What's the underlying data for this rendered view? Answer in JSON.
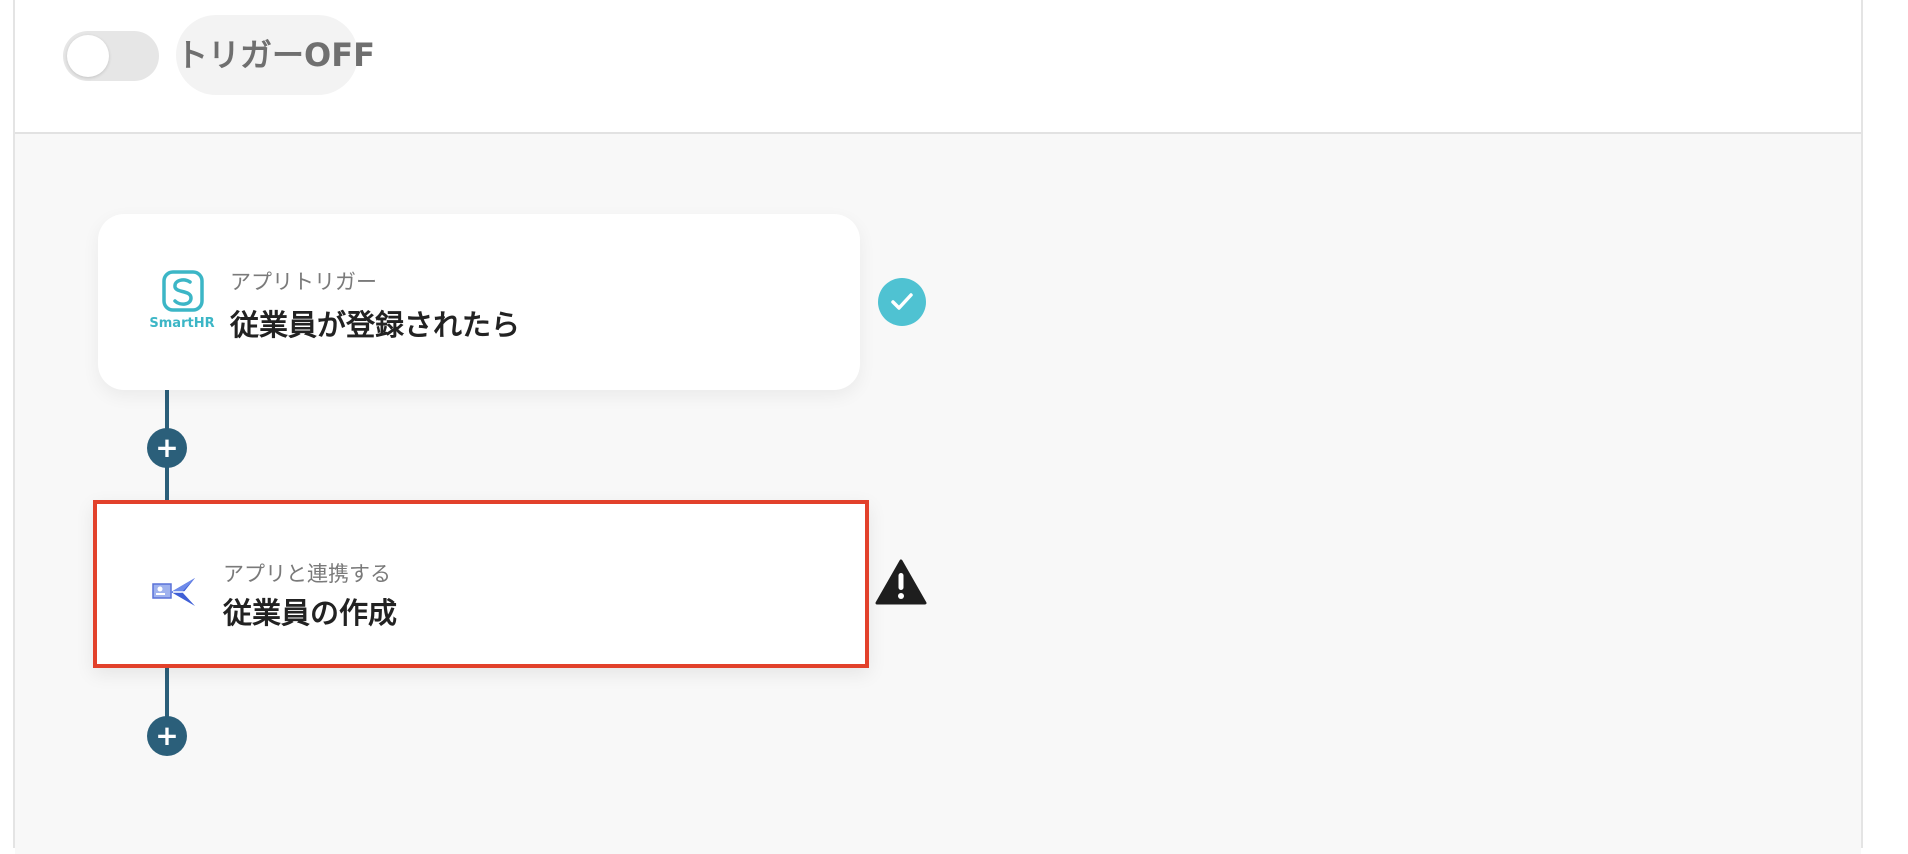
{
  "header": {
    "trigger_toggle": {
      "state": "off"
    },
    "trigger_label": "トリガーOFF"
  },
  "flow": {
    "steps": [
      {
        "app_icon": "smarthr-logo",
        "app_icon_text": "SmartHR",
        "subtitle": "アプリトリガー",
        "title": "従業員が登録された​ら",
        "status": "complete",
        "status_icon": "check-circle-icon"
      },
      {
        "app_icon": "paper-plane-app-icon",
        "subtitle": "アプリと連携する",
        "title": "従業員の作成",
        "status": "warning",
        "status_icon": "warning-triangle-icon",
        "highlighted": true
      }
    ],
    "add_step_symbol": "+"
  },
  "colors": {
    "connector": "#2b5f7a",
    "check": "#4fc2d2",
    "highlight_border": "#e2412b",
    "smarthr_brand": "#3cb6c6"
  }
}
